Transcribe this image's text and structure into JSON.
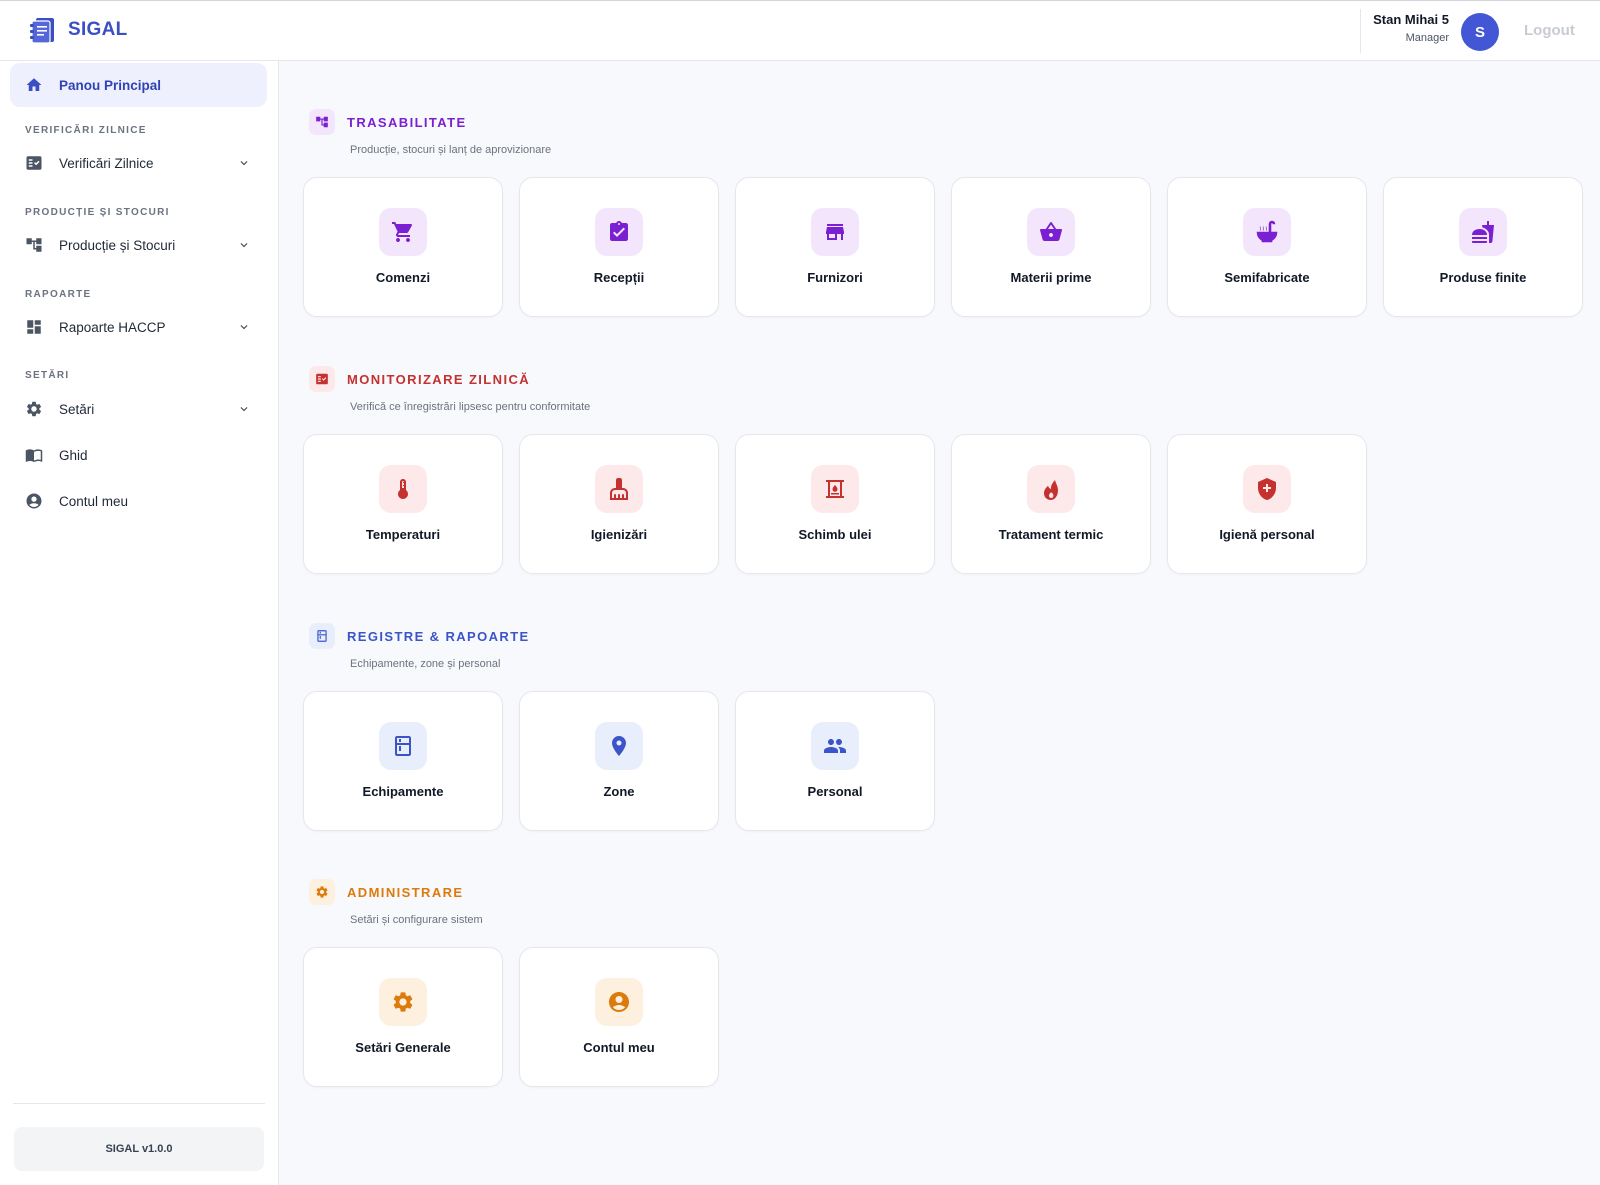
{
  "header": {
    "brand_name": "SIGAL",
    "user_name": "Stan Mihai 5",
    "user_role": "Manager",
    "avatar_initial": "S",
    "logout_label": "Logout"
  },
  "sidebar": {
    "active_item": "Panou Principal",
    "sections": [
      {
        "title": "VERIFICĂRI ZILNICE",
        "item": "Verificări Zilnice"
      },
      {
        "title": "PRODUCȚIE ȘI STOCURI",
        "item": "Producție și Stocuri"
      },
      {
        "title": "RAPOARTE",
        "item": "Rapoarte HACCP"
      },
      {
        "title": "SETĂRI",
        "item": "Setări"
      }
    ],
    "extra_items": [
      "Ghid",
      "Contul meu"
    ],
    "version": "SIGAL v1.0.0"
  },
  "main": {
    "sections": [
      {
        "title": "TRASABILITATE",
        "subtitle": "Producție, stocuri și lanț de aprovizionare",
        "color": "#7a1fd1",
        "cards": [
          {
            "label": "Comenzi",
            "icon": "cart-icon"
          },
          {
            "label": "Recepții",
            "icon": "clipboard-check-icon"
          },
          {
            "label": "Furnizori",
            "icon": "store-icon"
          },
          {
            "label": "Materii prime",
            "icon": "basket-icon"
          },
          {
            "label": "Semifabricate",
            "icon": "soup-icon"
          },
          {
            "label": "Produse finite",
            "icon": "fastfood-icon"
          }
        ]
      },
      {
        "title": "MONITORIZARE ZILNICĂ",
        "subtitle": "Verifică ce înregistrări lipsesc pentru conformitate",
        "color": "#c5312f",
        "cards": [
          {
            "label": "Temperaturi",
            "icon": "thermometer-icon"
          },
          {
            "label": "Igienizări",
            "icon": "brush-icon"
          },
          {
            "label": "Schimb ulei",
            "icon": "fryer-icon"
          },
          {
            "label": "Tratament termic",
            "icon": "fire-icon"
          },
          {
            "label": "Igienă personal",
            "icon": "health-shield-icon"
          }
        ]
      },
      {
        "title": "REGISTRE & RAPOARTE",
        "subtitle": "Echipamente, zone și personal",
        "color": "#3b55c9",
        "cards": [
          {
            "label": "Echipamente",
            "icon": "fridge-icon"
          },
          {
            "label": "Zone",
            "icon": "location-pin-icon"
          },
          {
            "label": "Personal",
            "icon": "people-icon"
          }
        ]
      },
      {
        "title": "ADMINISTRARE",
        "subtitle": "Setări și configurare sistem",
        "color": "#dc7a0b",
        "cards": [
          {
            "label": "Setări Generale",
            "icon": "gear-icon"
          },
          {
            "label": "Contul meu",
            "icon": "account-circle-icon"
          }
        ]
      }
    ]
  }
}
